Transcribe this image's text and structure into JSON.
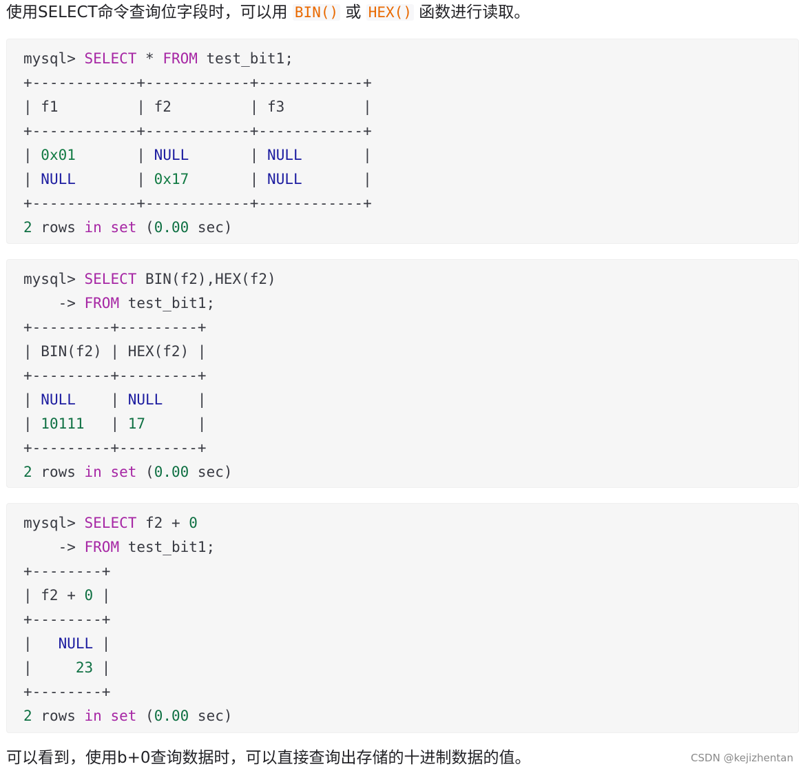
{
  "intro": {
    "text_a": "使用SELECT命令查询位字段时，可以用 ",
    "code_bin": "BIN()",
    "text_b": " 或 ",
    "code_hex": "HEX()",
    "text_c": " 函数进行读取。"
  },
  "block1": {
    "prompt": "mysql> ",
    "kw_select": "SELECT",
    "star": " * ",
    "kw_from": "FROM",
    "table": " test_bit1;",
    "border": "+------------+------------+------------+",
    "header": "| f1         | f2         | f3         |",
    "r1": {
      "p1": "| ",
      "c1": "0x01",
      "p2": "       | ",
      "c2": "NULL",
      "p3": "       | ",
      "c3": "NULL",
      "p4": "       |"
    },
    "r2": {
      "p1": "| ",
      "c1": "NULL",
      "p2": "       | ",
      "c2": "0x17",
      "p3": "       | ",
      "c3": "NULL",
      "p4": "       |"
    },
    "footer": {
      "n": "2",
      "rows": " rows ",
      "in": "in",
      "sp": " ",
      "set": "set",
      "open": " (",
      "time": "0.00",
      "close": " sec)"
    }
  },
  "block2": {
    "prompt": "mysql> ",
    "kw_select": "SELECT",
    "expr": " BIN(f2),HEX(f2)",
    "cont": "    -> ",
    "kw_from": "FROM",
    "table": " test_bit1;",
    "border": "+---------+---------+",
    "header": "| BIN(f2) | HEX(f2) |",
    "r1": {
      "p1": "| ",
      "c1": "NULL",
      "p2": "    | ",
      "c2": "NULL",
      "p3": "    |"
    },
    "r2": {
      "p1": "| ",
      "c1": "10111",
      "p2": "   | ",
      "c2": "17",
      "p3": "      |"
    },
    "footer": {
      "n": "2",
      "rows": " rows ",
      "in": "in",
      "sp": " ",
      "set": "set",
      "open": " (",
      "time": "0.00",
      "close": " sec)"
    }
  },
  "block3": {
    "prompt": "mysql> ",
    "kw_select": "SELECT",
    "expr": " f2 + ",
    "zero": "0",
    "cont": "    -> ",
    "kw_from": "FROM",
    "table": " test_bit1;",
    "border": "+--------+",
    "header": {
      "a": "| f2 + ",
      "zero": "0",
      "b": " |"
    },
    "r1": {
      "p1": "|   ",
      "c1": "NULL",
      "p2": " |"
    },
    "r2": {
      "p1": "|     ",
      "c1": "23",
      "p2": " |"
    },
    "footer": {
      "n": "2",
      "rows": " rows ",
      "in": "in",
      "sp": " ",
      "set": "set",
      "open": " (",
      "time": "0.00",
      "close": " sec)"
    }
  },
  "outro": "可以看到，使用b+0查询数据时，可以直接查询出存储的十进制数据的值。",
  "watermark": "CSDN @kejizhentan"
}
